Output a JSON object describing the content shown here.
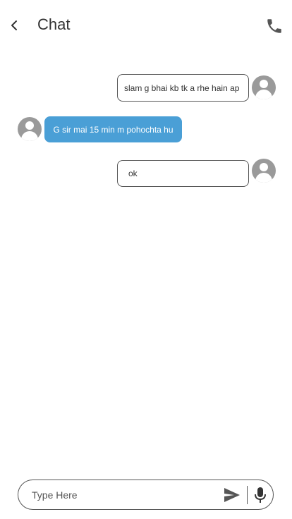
{
  "header": {
    "title": "Chat",
    "back_icon": "chevron-left-icon",
    "call_icon": "phone-icon"
  },
  "messages": [
    {
      "direction": "outgoing",
      "text": "slam g bhai kb tk a rhe hain ap"
    },
    {
      "direction": "incoming",
      "text": "G sir mai 15 min m pohochta hu"
    },
    {
      "direction": "outgoing",
      "text": "ok"
    }
  ],
  "composer": {
    "placeholder": "Type Here",
    "send_icon": "send-icon",
    "mic_icon": "mic-icon"
  },
  "colors": {
    "incoming_bubble": "#4a9fd6",
    "avatar": "#9a9a9a",
    "icon": "#555555",
    "title": "#333333"
  }
}
